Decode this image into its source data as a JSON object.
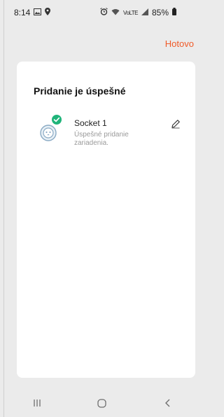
{
  "status_bar": {
    "time": "8:14",
    "icons_left": [
      "image-icon",
      "location-icon"
    ],
    "icons_right": [
      "alarm-icon",
      "wifi-icon",
      "signal-icon",
      "battery-icon"
    ],
    "network_text": "VoLTE",
    "battery": "85%"
  },
  "header": {
    "done_label": "Hotovo"
  },
  "card": {
    "title": "Pridanie je úspešné",
    "device": {
      "name": "Socket 1",
      "subtitle": "Úspešné pridanie zariadenia.",
      "status": "success",
      "icon": "socket-icon"
    }
  },
  "nav": {
    "icons": [
      "recents-icon",
      "home-icon",
      "back-icon"
    ]
  },
  "colors": {
    "accent": "#f05a28",
    "success": "#1fb47a",
    "background": "#ebebeb",
    "card": "#ffffff"
  }
}
